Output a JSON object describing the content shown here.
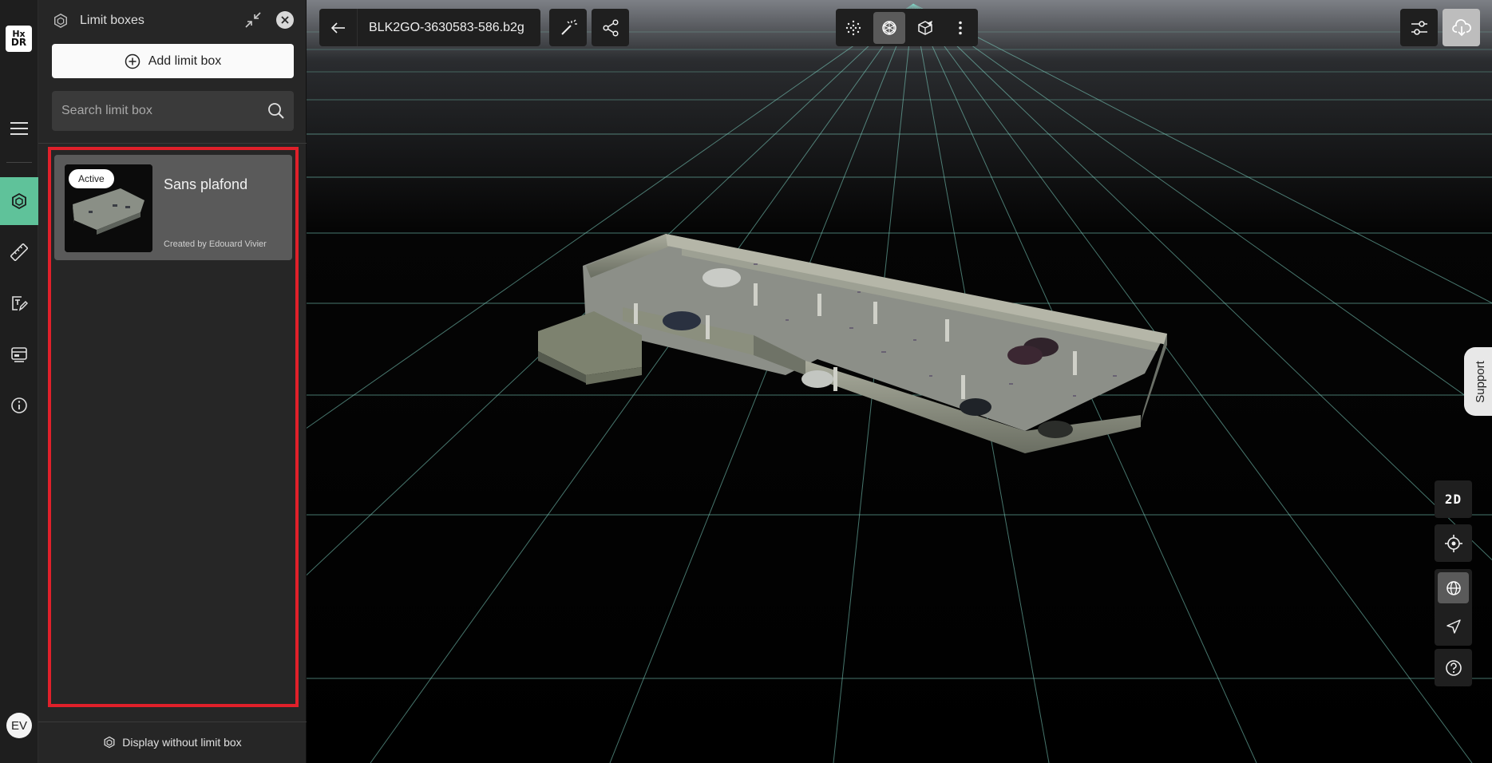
{
  "app": {
    "logo_top": "Hx",
    "logo_bottom": "DR"
  },
  "rail": {
    "items": [
      {
        "name": "menu-icon"
      },
      {
        "name": "limit-box-icon",
        "active": true
      },
      {
        "name": "measure-icon"
      },
      {
        "name": "annotate-icon"
      },
      {
        "name": "views-icon"
      },
      {
        "name": "info-icon"
      }
    ],
    "user_initials": "EV"
  },
  "panel": {
    "title": "Limit boxes",
    "add_label": "Add limit box",
    "search_placeholder": "Search limit box",
    "items": [
      {
        "badge": "Active",
        "title": "Sans plafond",
        "created_by": "Created by Edouard Vivier"
      }
    ],
    "footer_label": "Display without limit box"
  },
  "toolbar": {
    "filename": "BLK2GO-3630583-586.b2g",
    "view_modes": [
      "point-cloud-icon",
      "mesh-icon",
      "texture-icon"
    ],
    "selected_view_mode": "mesh-icon"
  },
  "right_controls": {
    "twod_label": "2D",
    "support_label": "Support"
  },
  "colors": {
    "accent": "#5fc29a",
    "highlight_border": "#e0202a",
    "grid": "#7fd6c4"
  }
}
